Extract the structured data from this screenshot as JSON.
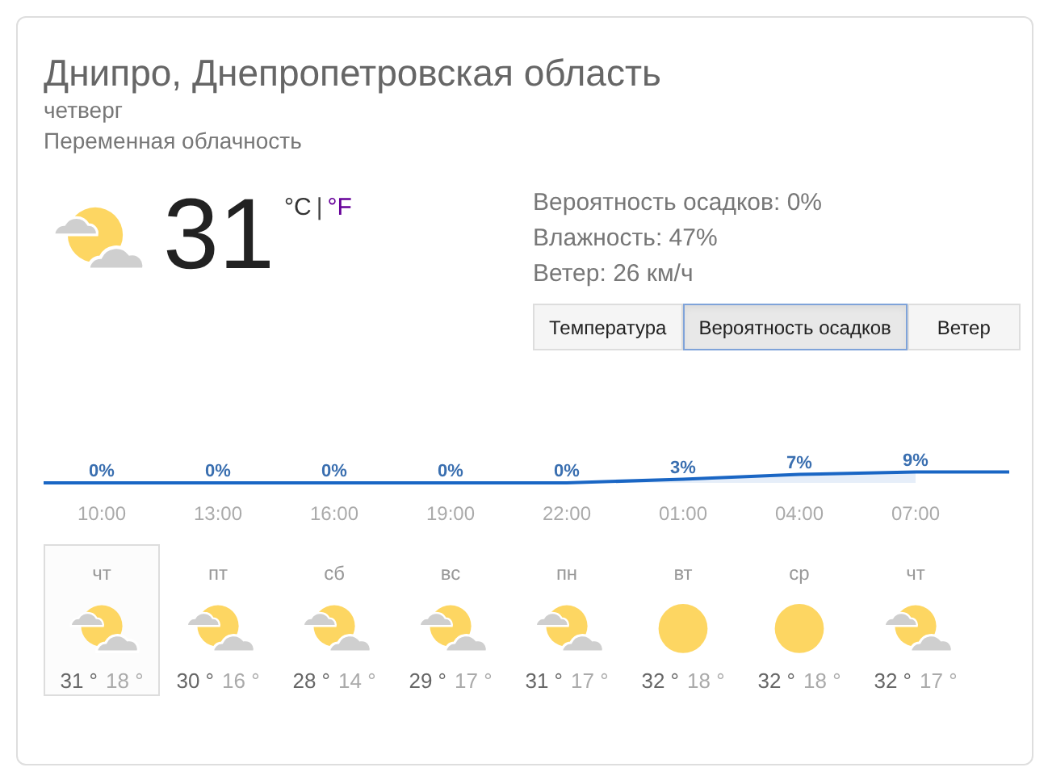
{
  "location": "Днипро, Днепропетровская область",
  "day": "четверг",
  "condition": "Переменная облачность",
  "current": {
    "kind": "partly-cloudy",
    "temperature": "31",
    "units": [
      {
        "label": "°C",
        "selected": true
      },
      {
        "label": "°F",
        "selected": false
      }
    ],
    "separator": "|"
  },
  "details": [
    "Вероятность осадков: 0%",
    "Влажность: 47%",
    "Ветер: 26 км/ч"
  ],
  "tabs": [
    {
      "label": "Температура",
      "selected": false
    },
    {
      "label": "Вероятность осадков",
      "selected": true
    },
    {
      "label": "Ветер",
      "selected": false
    }
  ],
  "precipitation": {
    "chart_data": {
      "type": "area",
      "categories": [
        "10:00",
        "13:00",
        "16:00",
        "19:00",
        "22:00",
        "01:00",
        "04:00",
        "07:00"
      ],
      "values": [
        0,
        0,
        0,
        0,
        0,
        3,
        7,
        9
      ],
      "value_labels": [
        "0%",
        "0%",
        "0%",
        "0%",
        "0%",
        "3%",
        "7%",
        "9%"
      ]
    }
  },
  "forecast": [
    {
      "day": "чт",
      "kind": "partly-cloudy",
      "high": "31 °",
      "low": "18 °",
      "selected": true
    },
    {
      "day": "пт",
      "kind": "partly-cloudy",
      "high": "30 °",
      "low": "16 °",
      "selected": false
    },
    {
      "day": "сб",
      "kind": "partly-cloudy",
      "high": "28 °",
      "low": "14 °",
      "selected": false
    },
    {
      "day": "вс",
      "kind": "partly-cloudy",
      "high": "29 °",
      "low": "17 °",
      "selected": false
    },
    {
      "day": "пн",
      "kind": "partly-cloudy",
      "high": "31 °",
      "low": "17 °",
      "selected": false
    },
    {
      "day": "вт",
      "kind": "sunny",
      "high": "32 °",
      "low": "18 °",
      "selected": false
    },
    {
      "day": "ср",
      "kind": "sunny",
      "high": "32 °",
      "low": "18 °",
      "selected": false
    },
    {
      "day": "чт",
      "kind": "partly-cloudy",
      "high": "32 °",
      "low": "17 °",
      "selected": false
    }
  ]
}
